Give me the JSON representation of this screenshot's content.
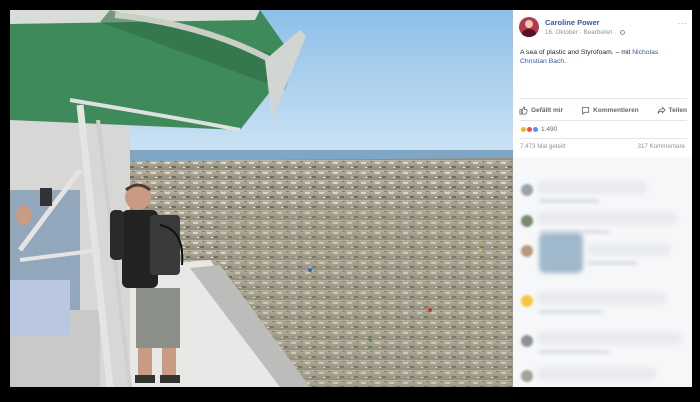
{
  "post": {
    "author": "Caroline Power",
    "date": "16. Oktober",
    "edited_label": "Bearbeitet",
    "text_before": "A sea of plastic and Styrofoam. – mit ",
    "tagged": "Nicholas Christian Bach",
    "text_after": "."
  },
  "actions": {
    "like": "Gefällt mir",
    "comment": "Kommentieren",
    "share": "Teilen"
  },
  "reactions": {
    "count": "1.490"
  },
  "stats": {
    "shares": "7.473 Mal geteilt",
    "comments": "317 Kommentare"
  },
  "colors": {
    "link": "#385898",
    "muted": "#90949c",
    "sky": "#9ec8ec",
    "canopy": "#3f8a5a"
  },
  "icons": [
    "like-icon",
    "comment-icon",
    "share-icon",
    "globe-icon",
    "more-icon"
  ]
}
